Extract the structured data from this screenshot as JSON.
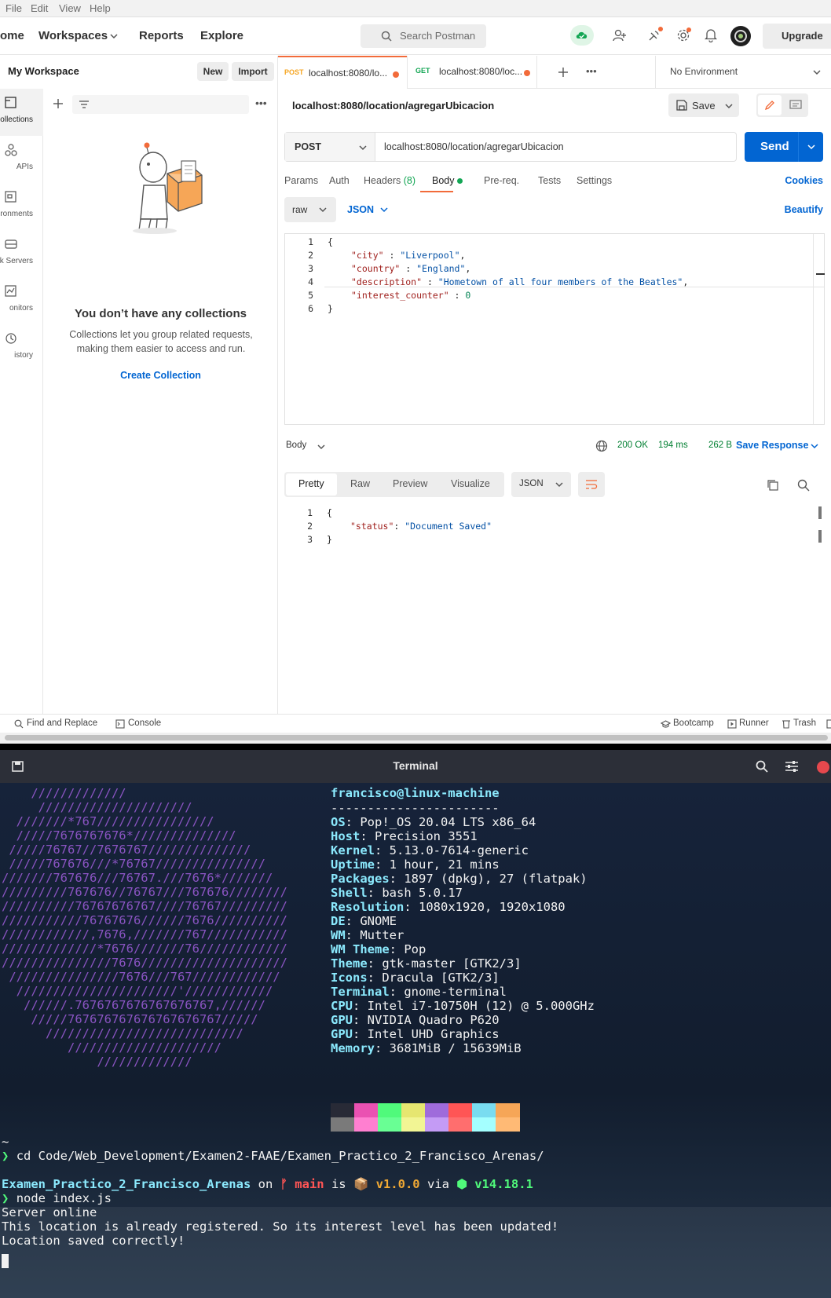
{
  "menubar": {
    "file": "File",
    "edit": "Edit",
    "view": "View",
    "help": "Help"
  },
  "header": {
    "home": "ome",
    "workspaces": "Workspaces",
    "reports": "Reports",
    "explore": "Explore",
    "search_label": "Search Postman",
    "upgrade": "Upgrade"
  },
  "sidebar": {
    "workspace_title": "My Workspace",
    "new_label": "New",
    "import_label": "Import",
    "rail": [
      {
        "label": "ollections",
        "icon": "collections-icon"
      },
      {
        "label": "APIs",
        "icon": "apis-icon"
      },
      {
        "label": "ronments",
        "icon": "environments-icon"
      },
      {
        "label": "k Servers",
        "icon": "mock-servers-icon"
      },
      {
        "label": "onitors",
        "icon": "monitors-icon"
      },
      {
        "label": "istory",
        "icon": "history-icon"
      }
    ],
    "empty_title": "You don’t have any collections",
    "empty_desc": "Collections let you group related requests, making them easier to access and run.",
    "create_collection": "Create Collection"
  },
  "tabs": [
    {
      "method": "POST",
      "url": "localhost:8080/lo...",
      "method_color": "#f6a623"
    },
    {
      "method": "GET",
      "url": "localhost:8080/loc...",
      "method_color": "#13a654"
    }
  ],
  "environment": "No Environment",
  "request": {
    "title": "localhost:8080/location/agregarUbicacion",
    "save_label": "Save",
    "method": "POST",
    "url": "localhost:8080/location/agregarUbicacion",
    "send_label": "Send",
    "tabs": {
      "params": "Params",
      "auth": "Auth",
      "headers": "Headers",
      "headers_count": "(8)",
      "body": "Body",
      "prereq": "Pre-req.",
      "tests": "Tests",
      "settings": "Settings"
    },
    "cookies": "Cookies",
    "body_mode": "raw",
    "body_lang": "JSON",
    "beautify": "Beautify",
    "body_lines": {
      "l1": "{",
      "city_key": "\"city\"",
      "city_val": "\"Liverpool\"",
      "country_key": "\"country\"",
      "country_val": "\"England\"",
      "desc_key": "\"description\"",
      "desc_val": "\"Hometown of all four members of the Beatles\"",
      "ic_key": "\"interest_counter\"",
      "ic_val": "0",
      "l6": "}"
    },
    "line_numbers": [
      "1",
      "2",
      "3",
      "4",
      "5",
      "6"
    ]
  },
  "response": {
    "body_label": "Body",
    "status": "200 OK",
    "time": "194 ms",
    "size": "262 B",
    "save_response": "Save Response",
    "views": {
      "pretty": "Pretty",
      "raw": "Raw",
      "preview": "Preview",
      "visualize": "Visualize"
    },
    "lang": "JSON",
    "lines": {
      "l1": "{",
      "status_key": "\"status\"",
      "status_val": "\"Document Saved\"",
      "l3": "}"
    },
    "line_numbers": [
      "1",
      "2",
      "3"
    ]
  },
  "statusbar": {
    "find_replace": "Find and Replace",
    "console": "Console",
    "bootcamp": "Bootcamp",
    "runner": "Runner",
    "trash": "Trash"
  },
  "terminal": {
    "title": "Terminal",
    "art": [
      "    /////////////",
      "     /////////////////////",
      "  ///////*767////////////////",
      "  /////7676767676*//////////////",
      " /////76767//7676767//////////////",
      " /////767676///*76767///////////////",
      "///////767676///76767.///7676*///////",
      "/////////767676//76767///767676////////",
      "//////////76767676767////76767/////////",
      "///////////76767676//////7676//////////",
      "////////////,7676,///////767///////////",
      "/////////////*7676///////76////////////",
      "///////////////7676////////////////////",
      " ///////////////7676///767////////////",
      "  //////////////////////'////////////",
      "   //////.7676767676767676767,//////",
      "    /////767676767676767676767/////",
      "      ///////////////////////////",
      "         /////////////////////",
      "             /////////////"
    ],
    "user_host": "francisco@linux-machine",
    "separator": "-----------------------",
    "info": [
      {
        "key": "OS",
        "value": "Pop!_OS 20.04 LTS x86_64"
      },
      {
        "key": "Host",
        "value": "Precision 3551"
      },
      {
        "key": "Kernel",
        "value": "5.13.0-7614-generic"
      },
      {
        "key": "Uptime",
        "value": "1 hour, 21 mins"
      },
      {
        "key": "Packages",
        "value": "1897 (dpkg), 27 (flatpak)"
      },
      {
        "key": "Shell",
        "value": "bash 5.0.17"
      },
      {
        "key": "Resolution",
        "value": "1080x1920, 1920x1080"
      },
      {
        "key": "DE",
        "value": "GNOME"
      },
      {
        "key": "WM",
        "value": "Mutter"
      },
      {
        "key": "WM Theme",
        "value": "Pop"
      },
      {
        "key": "Theme",
        "value": "gtk-master [GTK2/3]"
      },
      {
        "key": "Icons",
        "value": "Dracula [GTK2/3]"
      },
      {
        "key": "Terminal",
        "value": "gnome-terminal"
      },
      {
        "key": "CPU",
        "value": "Intel i7-10750H (12) @ 5.000GHz"
      },
      {
        "key": "GPU",
        "value": "NVIDIA Quadro P620"
      },
      {
        "key": "GPU",
        "value": "Intel UHD Graphics"
      },
      {
        "key": "Memory",
        "value": "3681MiB / 15639MiB"
      }
    ],
    "palette_top": [
      "#282a36",
      "#ea51b2",
      "#50fa7b",
      "#e6e670",
      "#9f6bdb",
      "#ff5555",
      "#79dcf0",
      "#f6a657"
    ],
    "palette_bottom": [
      "#7a7a7a",
      "#ff7fd0",
      "#69ff94",
      "#f2f594",
      "#c49bf5",
      "#ff6e6e",
      "#a4ffff",
      "#ffba75"
    ],
    "tilde": "~",
    "prompt_char": "❯",
    "cmd1": "cd Code/Web_Development/Examen2-FAAE/Examen_Practico_2_Francisco_Arenas/",
    "dir_name": "Examen_Practico_2_Francisco_Arenas",
    "on": "on",
    "branch_icon": "ᚠ",
    "branch": "main",
    "is": "is",
    "pkg_icon": "📦",
    "version": "v1.0.0",
    "via": "via",
    "node_icon": "⬢",
    "node_version": "v14.18.1",
    "cmd2": "node index.js",
    "out1": "Server online",
    "out2": "This location is already registered. So its interest level has been updated!",
    "out3": "Location saved correctly!"
  }
}
